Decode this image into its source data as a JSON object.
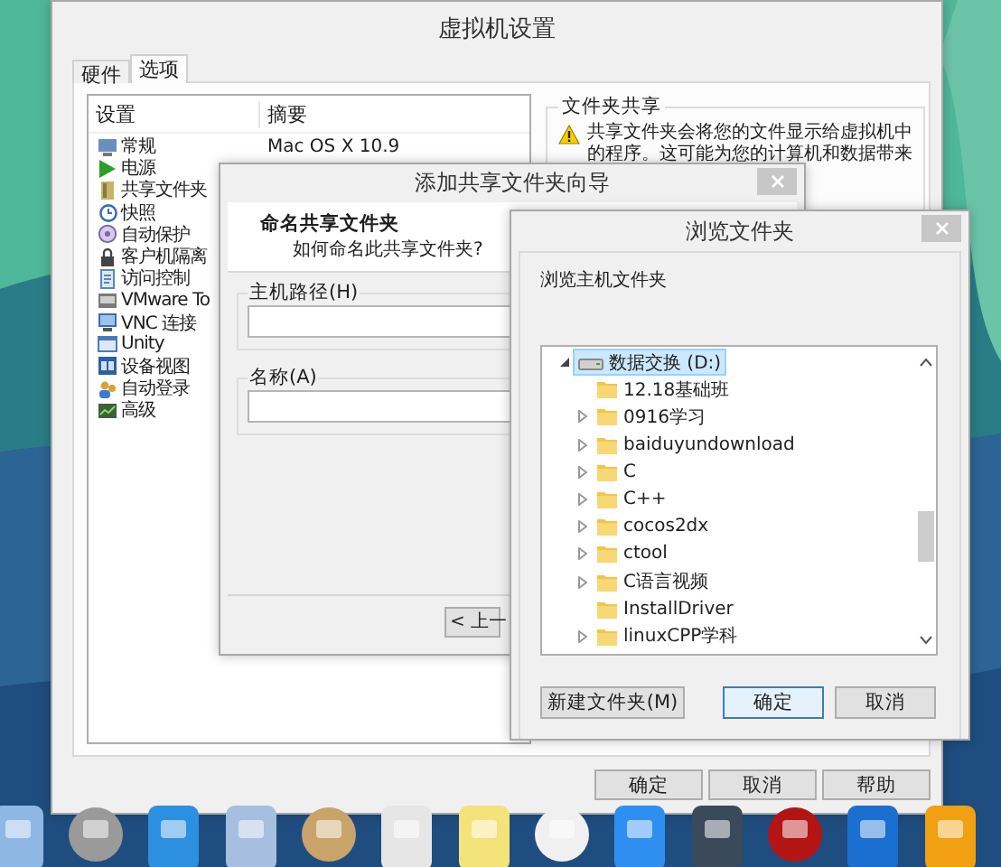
{
  "settings_window": {
    "title": "虚拟机设置",
    "tabs": [
      {
        "label": "硬件",
        "selected": false
      },
      {
        "label": "选项",
        "selected": true
      }
    ],
    "settings_list": {
      "columns": [
        "设置",
        "摘要"
      ],
      "items": [
        {
          "label": "常规",
          "summary": "Mac OS X 10.9"
        },
        {
          "label": "电源"
        },
        {
          "label": "共享文件夹"
        },
        {
          "label": "快照"
        },
        {
          "label": "自动保护"
        },
        {
          "label": "客户机隔离"
        },
        {
          "label": "访问控制"
        },
        {
          "label": "VMware To"
        },
        {
          "label": "VNC 连接"
        },
        {
          "label": "Unity"
        },
        {
          "label": "设备视图"
        },
        {
          "label": "自动登录"
        },
        {
          "label": "高级"
        }
      ]
    },
    "shared_folders": {
      "title": "文件夹共享",
      "warning": "共享文件夹会将您的文件显示给虚拟机中的程序。这可能为您的计算机和数据带来"
    },
    "buttons": [
      "确定",
      "取消",
      "帮助"
    ]
  },
  "wizard": {
    "title": "添加共享文件夹向导",
    "heading": "命名共享文件夹",
    "subheading": "如何命名此共享文件夹?",
    "fields": [
      {
        "label": "主机路径(H)"
      },
      {
        "label": "名称(A)"
      }
    ],
    "buttons": [
      "< 上一"
    ]
  },
  "browse_dialog": {
    "title": "浏览文件夹",
    "prompt": "浏览主机文件夹",
    "tree": {
      "label": "数据交换 (D:)",
      "expanded": true,
      "selected": true,
      "children": [
        {
          "label": "12.18基础班",
          "expandable": false
        },
        {
          "label": "0916学习",
          "expandable": true
        },
        {
          "label": "baiduyundownload",
          "expandable": true
        },
        {
          "label": "C",
          "expandable": true
        },
        {
          "label": "C++",
          "expandable": true
        },
        {
          "label": "cocos2dx",
          "expandable": true
        },
        {
          "label": "ctool",
          "expandable": true
        },
        {
          "label": "C语言视频",
          "expandable": true
        },
        {
          "label": "InstallDriver",
          "expandable": false
        },
        {
          "label": "linuxCPP学科",
          "expandable": true
        }
      ]
    },
    "buttons": [
      {
        "label": "新建文件夹(M)",
        "default": false
      },
      {
        "label": "确定",
        "default": true
      },
      {
        "label": "取消",
        "default": false
      }
    ]
  }
}
